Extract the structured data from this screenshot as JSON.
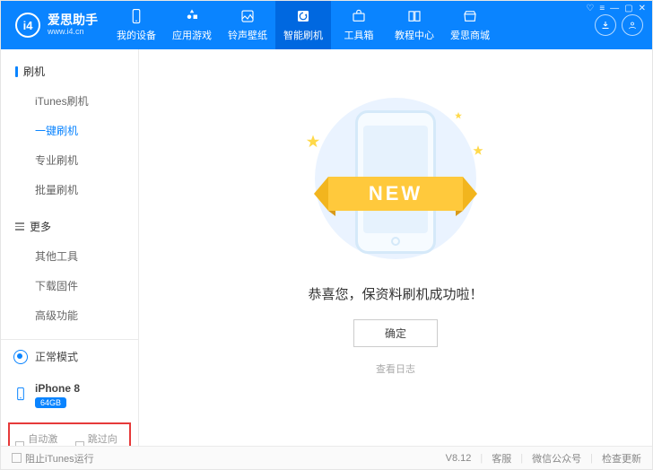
{
  "logo": {
    "badge": "i4",
    "title": "爱思助手",
    "subtitle": "www.i4.cn"
  },
  "nav": [
    {
      "name": "my-device",
      "label": "我的设备"
    },
    {
      "name": "app-games",
      "label": "应用游戏"
    },
    {
      "name": "ring-wall",
      "label": "铃声壁纸"
    },
    {
      "name": "smart-flash",
      "label": "智能刷机"
    },
    {
      "name": "toolbox",
      "label": "工具箱"
    },
    {
      "name": "tutorial",
      "label": "教程中心"
    },
    {
      "name": "mall",
      "label": "爱思商城"
    }
  ],
  "sidebar": {
    "section1_title": "刷机",
    "section1_items": [
      {
        "name": "itunes-flash",
        "label": "iTunes刷机"
      },
      {
        "name": "oneclick-flash",
        "label": "一键刷机"
      },
      {
        "name": "pro-flash",
        "label": "专业刷机"
      },
      {
        "name": "batch-flash",
        "label": "批量刷机"
      }
    ],
    "section2_title": "更多",
    "section2_items": [
      {
        "name": "other-tools",
        "label": "其他工具"
      },
      {
        "name": "download-fw",
        "label": "下载固件"
      },
      {
        "name": "advanced",
        "label": "高级功能"
      }
    ],
    "mode_label": "正常模式",
    "device_name": "iPhone 8",
    "device_capacity": "64GB",
    "opt_auto_activate": "自动激活",
    "opt_skip_guide": "跳过向导"
  },
  "main": {
    "banner_text": "NEW",
    "success_text": "恭喜您，保资料刷机成功啦！",
    "confirm_label": "确定",
    "view_log_label": "查看日志"
  },
  "footer": {
    "block_itunes": "阻止iTunes运行",
    "version": "V8.12",
    "support": "客服",
    "wechat": "微信公众号",
    "check_update": "检查更新"
  }
}
